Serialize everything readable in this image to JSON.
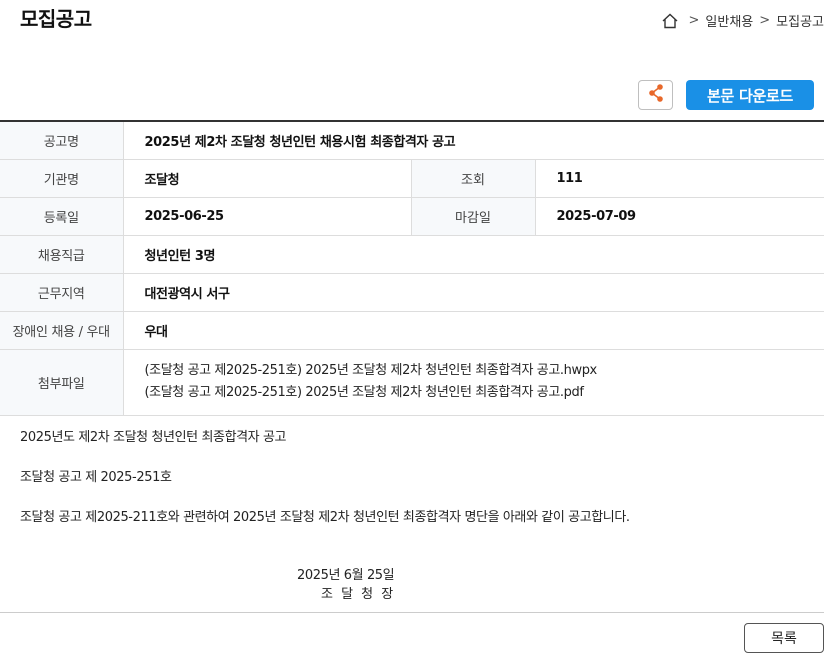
{
  "header": {
    "title": "모집공고",
    "breadcrumb": {
      "home_icon": "home-icon",
      "item1": "일반채용",
      "item2": "모집공고",
      "separator": ">"
    }
  },
  "toolbar": {
    "share_icon": "share-icon",
    "download_label": "본문 다운로드",
    "accent_color": "#1a90e6"
  },
  "info": {
    "title_label": "공고명",
    "title_value": "2025년 제2차 조달청 청년인턴 채용시험 최종합격자 공고",
    "agency_label": "기관명",
    "agency_value": "조달청",
    "views_label": "조회",
    "views_value": "111",
    "reg_label": "등록일",
    "reg_value": "2025-06-25",
    "deadline_label": "마감일",
    "deadline_value": "2025-07-09",
    "position_label": "채용직급",
    "position_value": "청년인턴 3명",
    "location_label": "근무지역",
    "location_value": "대전광역시 서구",
    "disability_label": "장애인 채용 / 우대",
    "disability_value": "우대",
    "files_label": "첨부파일",
    "files": [
      "(조달청 공고 제2025-251호) 2025년 조달청 제2차 청년인턴 최종합격자 공고.hwpx",
      "(조달청 공고 제2025-251호) 2025년 조달청 제2차 청년인턴 최종합격자 공고.pdf"
    ]
  },
  "body": {
    "line1": "2025년도 제2차 조달청 청년인턴 최종합격자 공고",
    "line2": "조달청 공고 제 2025-251호",
    "line3": "조달청 공고 제2025-211호와 관련하여 2025년 조달청 제2차 청년인턴 최종합격자 명단을 아래와 같이 공고합니다.",
    "date": "2025년 6월 25일",
    "signer": "조 달 청 장"
  },
  "footer": {
    "list_label": "목록"
  }
}
